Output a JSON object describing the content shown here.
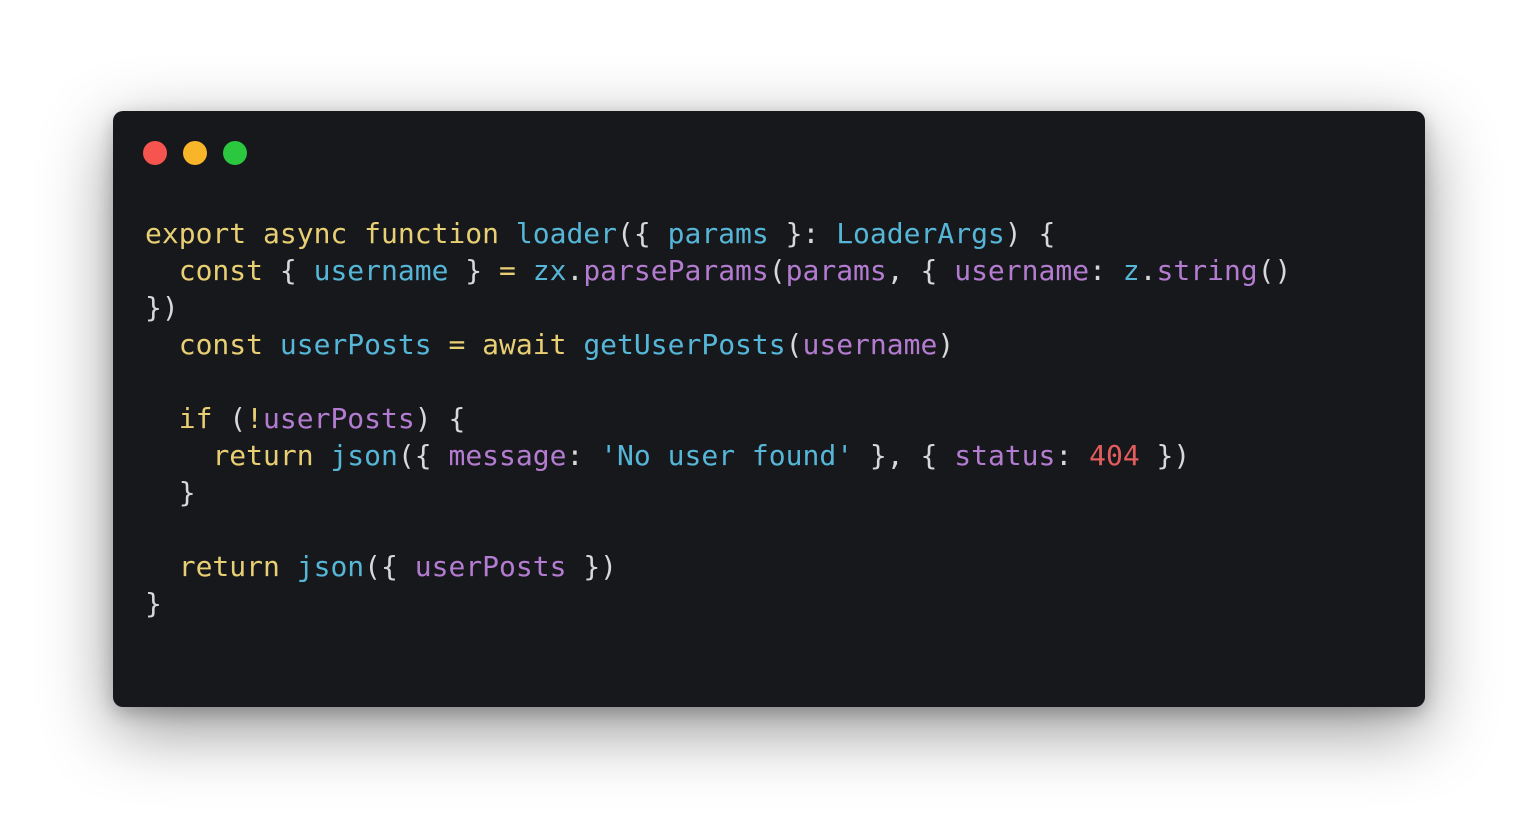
{
  "window": {
    "buttons": [
      {
        "name": "close",
        "color": "#f6544e"
      },
      {
        "name": "minimize",
        "color": "#f9b52a"
      },
      {
        "name": "zoom",
        "color": "#2ac73f"
      }
    ]
  },
  "theme": {
    "plain": "#d8d8d8",
    "keyword": "#e8cf74",
    "function": "#56b6d8",
    "variable": "#b37cd1",
    "string": "#56b6d8",
    "number": "#e35d5d"
  },
  "code": {
    "lines": [
      [
        [
          "keyword",
          "export async function "
        ],
        [
          "function",
          "loader"
        ],
        [
          "plain",
          "({ "
        ],
        [
          "function",
          "params"
        ],
        [
          "plain",
          " }: "
        ],
        [
          "function",
          "LoaderArgs"
        ],
        [
          "plain",
          ") {"
        ]
      ],
      [
        [
          "plain",
          "  "
        ],
        [
          "keyword",
          "const"
        ],
        [
          "plain",
          " { "
        ],
        [
          "function",
          "username"
        ],
        [
          "plain",
          " } "
        ],
        [
          "keyword",
          "="
        ],
        [
          "plain",
          " "
        ],
        [
          "function",
          "zx"
        ],
        [
          "plain",
          "."
        ],
        [
          "variable",
          "parseParams"
        ],
        [
          "plain",
          "("
        ],
        [
          "variable",
          "params"
        ],
        [
          "plain",
          ", { "
        ],
        [
          "variable",
          "username"
        ],
        [
          "plain",
          ": "
        ],
        [
          "function",
          "z"
        ],
        [
          "plain",
          "."
        ],
        [
          "variable",
          "string"
        ],
        [
          "plain",
          "()"
        ]
      ],
      [
        [
          "plain",
          "})"
        ]
      ],
      [
        [
          "plain",
          "  "
        ],
        [
          "keyword",
          "const"
        ],
        [
          "plain",
          " "
        ],
        [
          "function",
          "userPosts"
        ],
        [
          "plain",
          " "
        ],
        [
          "keyword",
          "= await"
        ],
        [
          "plain",
          " "
        ],
        [
          "function",
          "getUserPosts"
        ],
        [
          "plain",
          "("
        ],
        [
          "variable",
          "username"
        ],
        [
          "plain",
          ")"
        ]
      ],
      [],
      [
        [
          "plain",
          "  "
        ],
        [
          "keyword",
          "if"
        ],
        [
          "plain",
          " ("
        ],
        [
          "keyword",
          "!"
        ],
        [
          "variable",
          "userPosts"
        ],
        [
          "plain",
          ") {"
        ]
      ],
      [
        [
          "plain",
          "    "
        ],
        [
          "keyword",
          "return"
        ],
        [
          "plain",
          " "
        ],
        [
          "function",
          "json"
        ],
        [
          "plain",
          "({ "
        ],
        [
          "variable",
          "message"
        ],
        [
          "plain",
          ": "
        ],
        [
          "string",
          "'No user found'"
        ],
        [
          "plain",
          " }, { "
        ],
        [
          "variable",
          "status"
        ],
        [
          "plain",
          ": "
        ],
        [
          "number",
          "404"
        ],
        [
          "plain",
          " })"
        ]
      ],
      [
        [
          "plain",
          "  }"
        ]
      ],
      [],
      [
        [
          "plain",
          "  "
        ],
        [
          "keyword",
          "return"
        ],
        [
          "plain",
          " "
        ],
        [
          "function",
          "json"
        ],
        [
          "plain",
          "({ "
        ],
        [
          "variable",
          "userPosts"
        ],
        [
          "plain",
          " })"
        ]
      ],
      [
        [
          "plain",
          "}"
        ]
      ]
    ]
  }
}
